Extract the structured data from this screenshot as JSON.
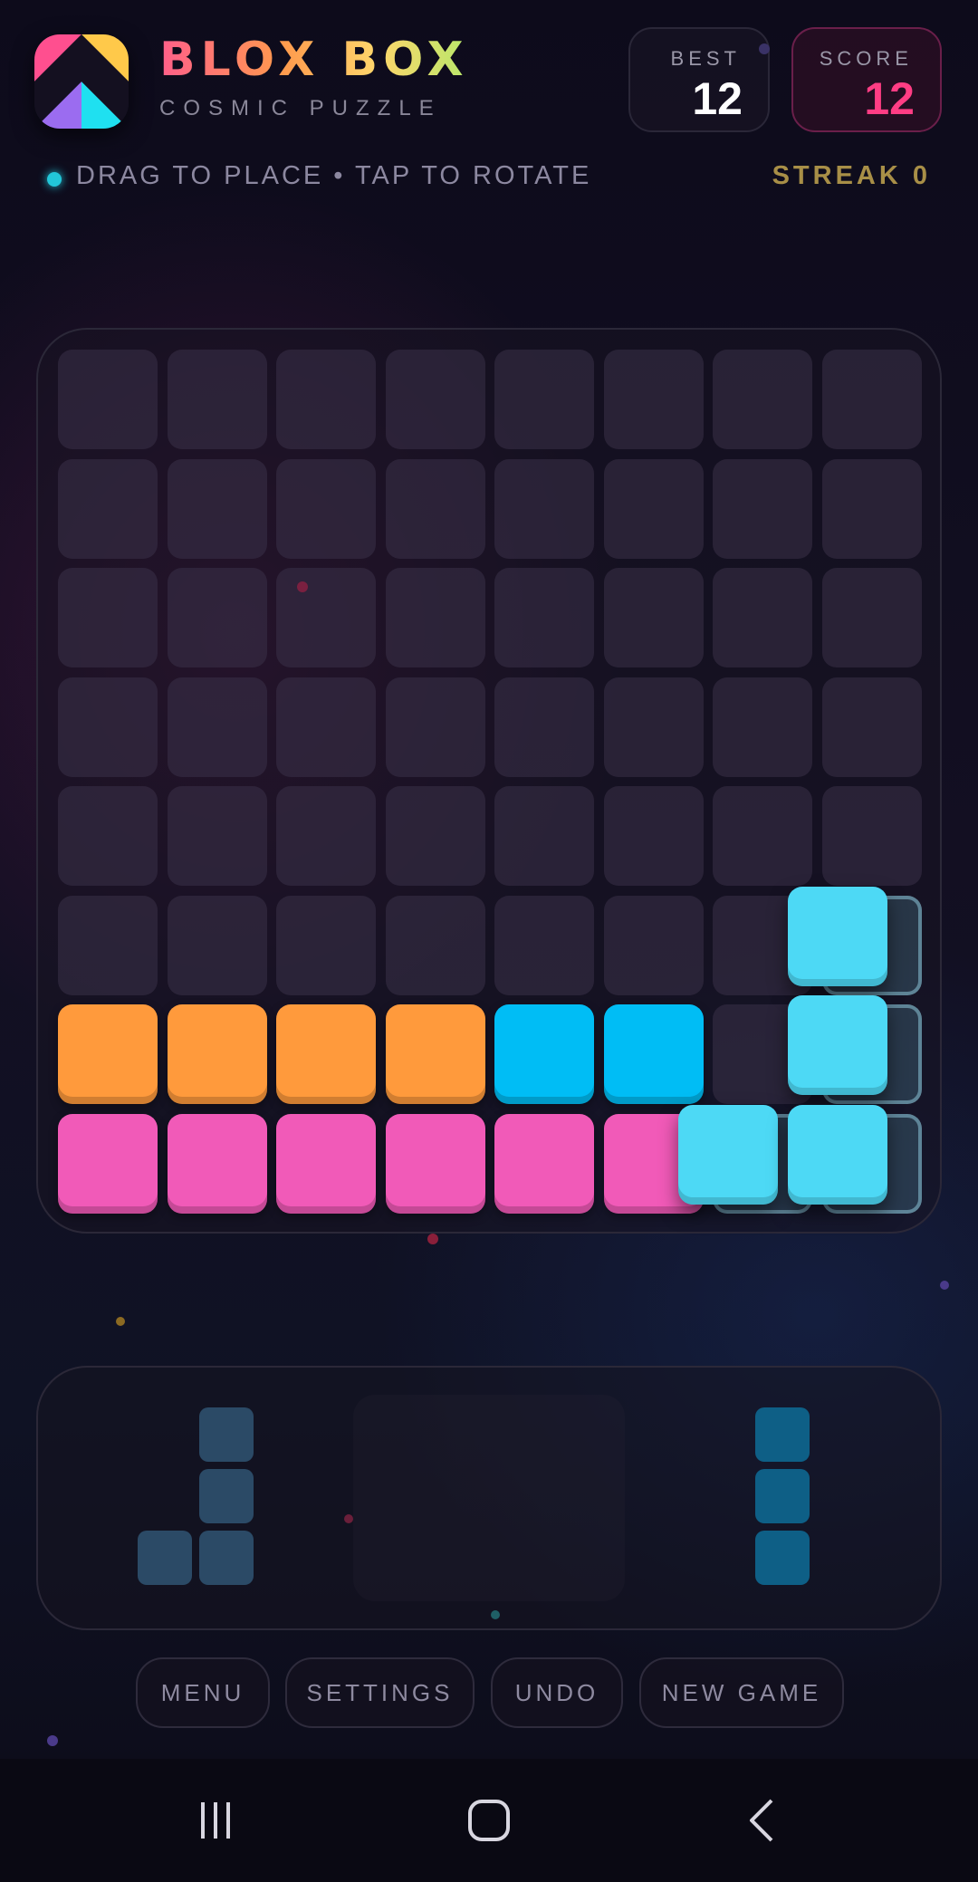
{
  "header": {
    "title": "BLOX BOX",
    "subtitle": "COSMIC PUZZLE",
    "logo_icon": "blox-box-logo",
    "best_label": "BEST",
    "best_value": "12",
    "score_label": "SCORE",
    "score_value": "12"
  },
  "hint": "DRAG TO PLACE • TAP TO ROTATE",
  "streak": "STREAK 0",
  "colors": {
    "orange": "#ff9a3c",
    "blue": "#00bdf5",
    "pink": "#f15ab8",
    "drag_cyan": "#4dd9f5",
    "score_pink": "#ff3d84",
    "accent_gold": "#a88f47"
  },
  "board": {
    "size": 8,
    "rows": [
      [
        "",
        "",
        "",
        "",
        "",
        "",
        "",
        ""
      ],
      [
        "",
        "",
        "",
        "",
        "",
        "",
        "",
        ""
      ],
      [
        "",
        "",
        "",
        "",
        "",
        "",
        "",
        ""
      ],
      [
        "",
        "",
        "",
        "",
        "",
        "",
        "",
        ""
      ],
      [
        "",
        "",
        "",
        "",
        "",
        "",
        "",
        ""
      ],
      [
        "",
        "",
        "",
        "",
        "",
        "",
        "",
        "ghost"
      ],
      [
        "orange",
        "orange",
        "orange",
        "orange",
        "blue",
        "blue",
        "",
        "ghost"
      ],
      [
        "pink",
        "pink",
        "pink",
        "pink",
        "pink",
        "pink",
        "ghost",
        "ghost"
      ]
    ],
    "dragged_piece": "J-shape (cyan)"
  },
  "tray": {
    "pieces": [
      {
        "name": "J-shape",
        "color": "#2b4a66",
        "cells": [
          [
            0,
            1
          ],
          [
            1,
            1
          ],
          [
            2,
            0
          ],
          [
            2,
            1
          ]
        ]
      },
      {
        "name": "empty-slot",
        "color": "",
        "cells": []
      },
      {
        "name": "I3-vertical",
        "color": "#0e5f86",
        "cells": [
          [
            0,
            0
          ],
          [
            1,
            0
          ],
          [
            2,
            0
          ]
        ]
      }
    ]
  },
  "buttons": {
    "menu": "MENU",
    "settings": "SETTINGS",
    "undo": "UNDO",
    "new_game": "NEW GAME"
  },
  "navbar": {
    "recent_icon": "recent-apps-icon",
    "home_icon": "home-icon",
    "back_icon": "back-icon"
  }
}
